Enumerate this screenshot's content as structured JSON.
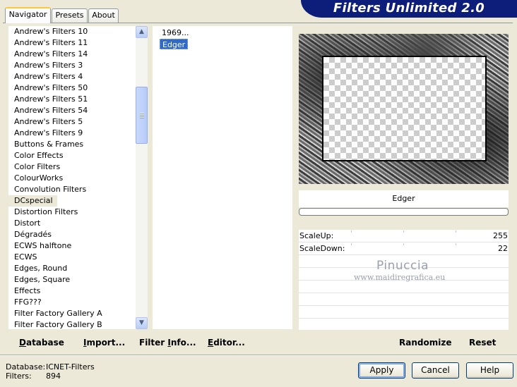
{
  "window": {
    "title": "Filters Unlimited 2.0"
  },
  "tabs": [
    {
      "label": "Navigator",
      "active": true
    },
    {
      "label": "Presets",
      "active": false
    },
    {
      "label": "About",
      "active": false
    }
  ],
  "categories": [
    "Andrew's Filters 10",
    "Andrew's Filters 11",
    "Andrew's Filters 14",
    "Andrew's Filters 3",
    "Andrew's Filters 4",
    "Andrew's Filters 50",
    "Andrew's Filters 51",
    "Andrew's Filters 54",
    "Andrew's Filters 5",
    "Andrew's Filters 9",
    "Buttons & Frames",
    "Color Effects",
    "Color Filters",
    "ColourWorks",
    "Convolution Filters",
    "DCspecial",
    "Distortion Filters",
    "Distort",
    "Dégradés",
    "ECWS halftone",
    "ECWS",
    "Edges, Round",
    "Edges, Square",
    "Effects",
    "FFG???",
    "Filter Factory Gallery A",
    "Filter Factory Gallery B"
  ],
  "selected_category": "DCspecial",
  "filters": [
    "1969...",
    "Edger"
  ],
  "selected_filter": "Edger",
  "preview": {
    "filter_name": "Edger"
  },
  "params": [
    {
      "label": "ScaleUp:",
      "value": "255"
    },
    {
      "label": "ScaleDown:",
      "value": "22"
    }
  ],
  "watermark": {
    "name": "Pinuccia",
    "url": "www.maidiregrafica.eu"
  },
  "left_toolbar": {
    "database": {
      "u": "D",
      "rest": "atabase"
    },
    "import": {
      "u": "I",
      "rest": "mport..."
    },
    "filter_info": {
      "pre": "Filter ",
      "u": "I",
      "rest": "nfo..."
    },
    "editor": {
      "u": "E",
      "rest": "ditor..."
    }
  },
  "right_toolbar": {
    "randomize": "Randomize",
    "reset": "Reset"
  },
  "status": {
    "database_label": "Database:",
    "database_value": "ICNET-Filters",
    "filters_label": "Filters:",
    "filters_value": "894"
  },
  "buttons": {
    "apply": "Apply",
    "cancel": "Cancel",
    "help": "Help"
  },
  "colors": {
    "banner": "#0c1e7a",
    "selection": "#316ac5",
    "tab_highlight": "#ffc83c"
  }
}
